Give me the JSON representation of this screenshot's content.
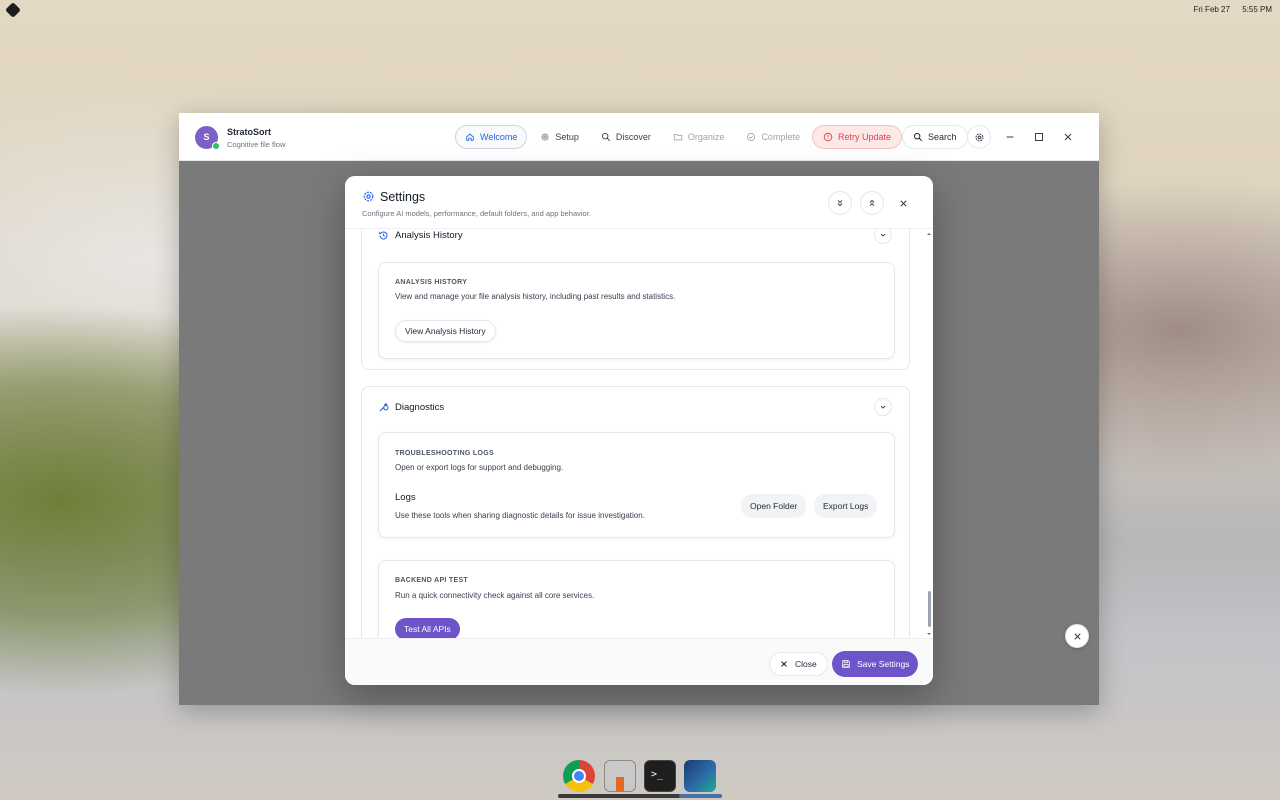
{
  "system": {
    "date": "Fri Feb 27",
    "time": "5:55 PM"
  },
  "app": {
    "avatar_letter": "S",
    "name": "StratoSort",
    "tagline": "Cognitive file flow",
    "nav": [
      {
        "label": "Welcome",
        "icon": "home-icon",
        "state": "active"
      },
      {
        "label": "Setup",
        "icon": "gear-icon",
        "state": "normal"
      },
      {
        "label": "Discover",
        "icon": "search-icon",
        "state": "normal"
      },
      {
        "label": "Organize",
        "icon": "folder-icon",
        "state": "disabled"
      },
      {
        "label": "Complete",
        "icon": "check-circle-icon",
        "state": "disabled"
      }
    ],
    "retry_label": "Retry Update",
    "search_label": "Search",
    "colors": {
      "accent": "#2563eb",
      "brand_purple": "#6d54c9",
      "danger": "#e0444e"
    }
  },
  "settings": {
    "title": "Settings",
    "subtitle": "Configure AI models, performance, default folders, and app behavior.",
    "analysis_history": {
      "section_title": "Analysis History",
      "card_label": "ANALYSIS HISTORY",
      "card_desc": "View and manage your file analysis history, including past results and statistics.",
      "button": "View Analysis History"
    },
    "diagnostics": {
      "section_title": "Diagnostics",
      "logs_card": {
        "label": "TROUBLESHOOTING LOGS",
        "desc": "Open or export logs for support and debugging.",
        "subtitle": "Logs",
        "subdesc": "Use these tools when sharing diagnostic details for issue investigation.",
        "open_button": "Open Folder",
        "export_button": "Export Logs"
      },
      "api_card": {
        "label": "BACKEND API TEST",
        "desc": "Run a quick connectivity check against all core services.",
        "button": "Test All APIs"
      }
    },
    "footer": {
      "close_label": "Close",
      "save_label": "Save Settings"
    }
  }
}
